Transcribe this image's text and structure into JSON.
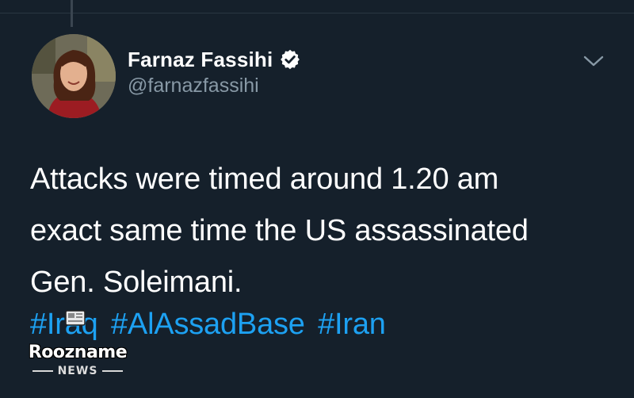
{
  "tweet": {
    "author": {
      "display_name": "Farnaz Fassihi",
      "handle": "@farnazfassihi",
      "verified": true
    },
    "text_lines": [
      "Attacks were timed around 1.20 am",
      "exact same time the US assassinated",
      "Gen. Soleimani."
    ],
    "hashtags": [
      "#Iraq",
      "#AlAssadBase",
      "#Iran"
    ]
  },
  "watermark": {
    "name": "Roozname",
    "sub": "NEWS"
  },
  "icons": {
    "verified": "verified-badge-icon",
    "menu": "chevron-down-icon"
  },
  "colors": {
    "background": "#15202b",
    "text": "#ffffff",
    "secondary_text": "#8899a6",
    "link": "#1da1f2"
  }
}
